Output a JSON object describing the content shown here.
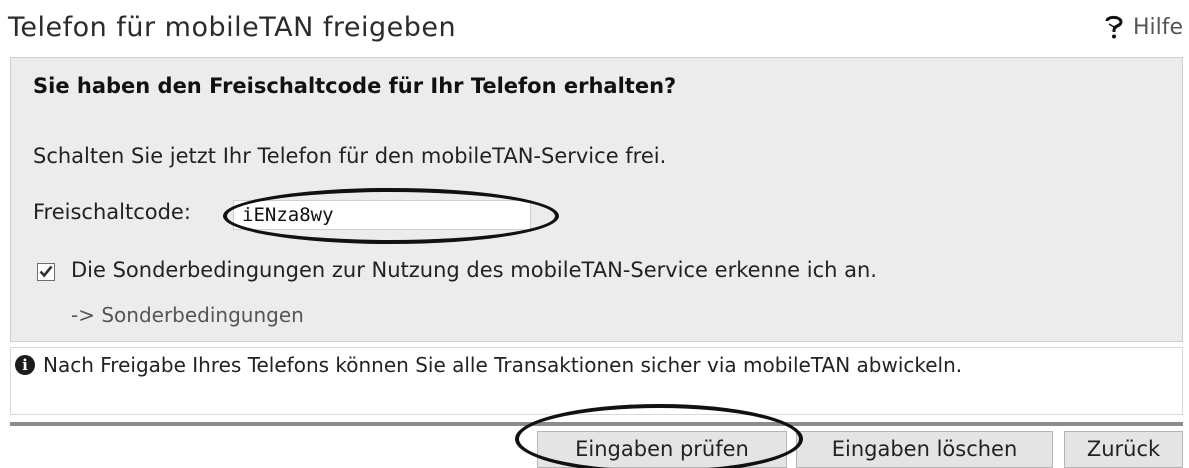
{
  "header": {
    "title": "Telefon für mobileTAN freigeben",
    "help_label": "Hilfe",
    "help_icon": "help-icon"
  },
  "panel": {
    "heading": "Sie haben den Freischaltcode für Ihr Telefon erhalten?",
    "instruction": "Schalten Sie jetzt Ihr Telefon für den mobileTAN-Service frei.",
    "code_label": "Freischaltcode:",
    "code_value": "iENza8wy",
    "terms_checkbox_checked": true,
    "terms_checkbox_label": "Die Sonderbedingungen zur Nutzung des mobileTAN-Service erkenne ich an.",
    "terms_link": "-> Sonderbedingungen"
  },
  "info": {
    "icon": "info-icon",
    "text": "Nach Freigabe Ihres Telefons können Sie alle Transaktionen sicher via mobileTAN abwickeln."
  },
  "buttons": {
    "check": "Eingaben prüfen",
    "clear": "Eingaben löschen",
    "back": "Zurück"
  },
  "colors": {
    "panel_background": "#ececec",
    "button_background": "#e4e4e4",
    "annotation_ellipse": "#111111"
  }
}
